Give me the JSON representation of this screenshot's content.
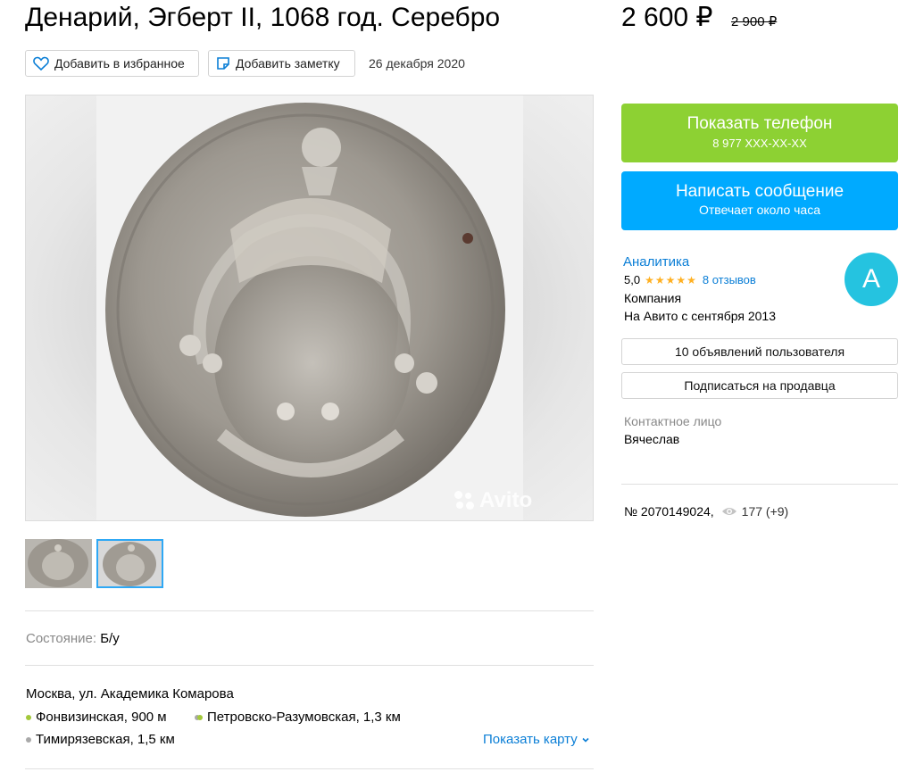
{
  "listing": {
    "title": "Денарий, Эгберт II, 1068 год. Серебро",
    "price": "2 600 ₽",
    "old_price": "2 900 ₽",
    "date": "26 декабря 2020"
  },
  "actions": {
    "favorite_label": "Добавить в избранное",
    "note_label": "Добавить заметку"
  },
  "gallery": {
    "watermark": "Avito",
    "thumbnails": [
      "coin-obverse",
      "coin-detail"
    ],
    "selected_thumbnail": 2
  },
  "params": {
    "condition_label": "Состояние:",
    "condition_value": "Б/у"
  },
  "location": {
    "address": "Москва, ул. Академика Комарова",
    "metro": [
      {
        "name": "Фонвизинская, 900 м",
        "color": "#a3c83a"
      },
      {
        "name": "Петровско-Разумовская, 1,3 км",
        "color": "#a3c83a"
      },
      {
        "name": "Тимирязевская, 1,5 км",
        "color": "#a9a9a9"
      }
    ],
    "show_map": "Показать карту"
  },
  "contact": {
    "phone_button": "Показать телефон",
    "phone_masked": "8 977 XXX-XX-XX",
    "message_button": "Написать сообщение",
    "message_hint": "Отвечает около часа"
  },
  "seller": {
    "name": "Аналитика",
    "rating": "5,0",
    "stars": "★★★★★",
    "reviews": "8 отзывов",
    "type": "Компания",
    "since": "На Авито с сентября 2013",
    "avatar_letter": "А",
    "avatar_color": "#25c3e0",
    "ads_button": "10 объявлений пользователя",
    "subscribe_button": "Подписаться на продавца",
    "contact_label": "Контактное лицо",
    "contact_name": "Вячеслав"
  },
  "meta": {
    "ad_number": "№ 2070149024,",
    "views": "177 (+9)"
  },
  "colors": {
    "phone_button": "#8dd133",
    "message_button": "#00aaff",
    "link": "#0a7ed6",
    "stars": "#ffb021"
  }
}
